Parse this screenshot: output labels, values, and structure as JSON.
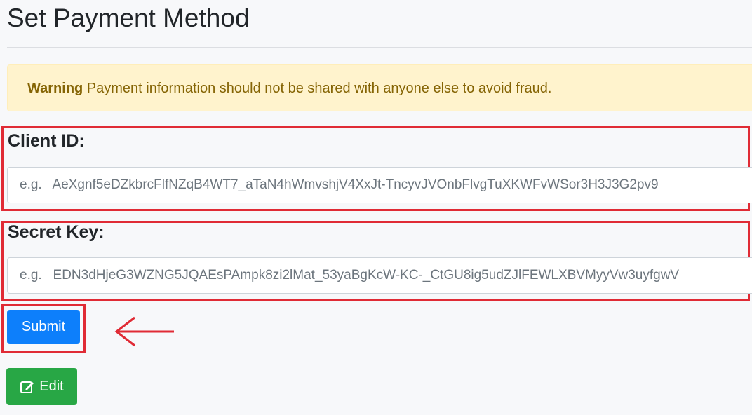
{
  "page": {
    "title": "Set Payment Method"
  },
  "alert": {
    "strong": "Warning",
    "message": " Payment information should not be shared with anyone else to avoid fraud."
  },
  "form": {
    "client_id": {
      "label": "Client ID:",
      "placeholder": "e.g.   AeXgnf5eDZkbrcFlfNZqB4WT7_aTaN4hWmvshjV4XxJt-TncyvJVOnbFlvgTuXKWFvWSor3H3J3G2pv9"
    },
    "secret_key": {
      "label": "Secret Key:",
      "placeholder": "e.g.   EDN3dHjeG3WZNG5JQAEsPAmpk8zi2lMat_53yaBgKcW-KC-_CtGU8ig5udZJlFEWLXBVMyyVw3uyfgwV"
    },
    "submit_label": "Submit"
  },
  "edit": {
    "label": "Edit",
    "icon": "edit-icon"
  },
  "colors": {
    "primary": "#0d7ffb",
    "success": "#28a745",
    "warning_bg": "#fff3cd",
    "warning_text": "#856404",
    "annotation": "#e02b35"
  }
}
